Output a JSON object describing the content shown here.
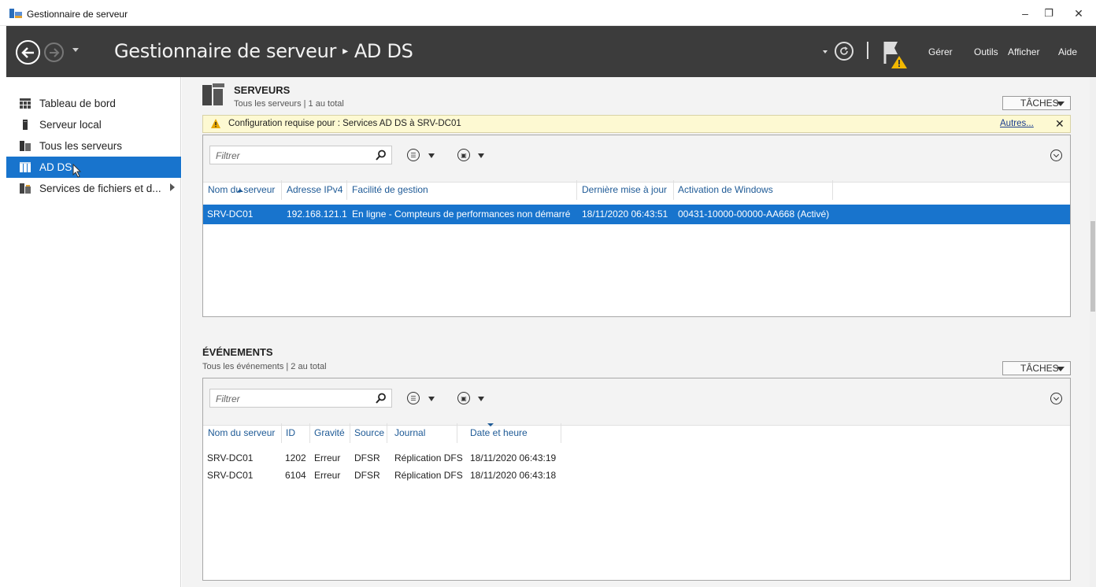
{
  "window": {
    "title": "Gestionnaire de serveur",
    "controls": {
      "minimize": "–",
      "restore": "❐",
      "close": "✕"
    }
  },
  "header": {
    "breadcrumb_root": "Gestionnaire de serveur",
    "breadcrumb_sep": "▸",
    "breadcrumb_current": "AD DS",
    "menu": {
      "manage": "Gérer",
      "tools": "Outils",
      "view": "Afficher",
      "help": "Aide"
    }
  },
  "sidebar": {
    "items": [
      {
        "label": "Tableau de bord",
        "icon": "dashboard-icon"
      },
      {
        "label": "Serveur local",
        "icon": "local-server-icon"
      },
      {
        "label": "Tous les serveurs",
        "icon": "all-servers-icon"
      },
      {
        "label": "AD DS",
        "icon": "ad-ds-icon",
        "active": true
      },
      {
        "label": "Services de fichiers et d...",
        "icon": "file-services-icon"
      }
    ]
  },
  "servers": {
    "title": "SERVEURS",
    "subtitle": "Tous les serveurs | 1 au total",
    "tasks_label": "TÂCHES",
    "notice": {
      "message": "Configuration requise pour : Services AD DS à SRV-DC01",
      "more_link": "Autres...",
      "close": "✕"
    },
    "filter_placeholder": "Filtrer",
    "columns": [
      "Nom du serveur",
      "Adresse IPv4",
      "Facilité de gestion",
      "Dernière mise à jour",
      "Activation de Windows"
    ],
    "rows": [
      [
        "SRV-DC01",
        "192.168.121.1",
        "En ligne - Compteurs de performances non démarré",
        "18/11/2020 06:43:51",
        "00431-10000-00000-AA668 (Activé)"
      ]
    ]
  },
  "events": {
    "title": "ÉVÉNEMENTS",
    "subtitle": "Tous les événements | 2 au total",
    "tasks_label": "TÂCHES",
    "filter_placeholder": "Filtrer",
    "columns": [
      "Nom du serveur",
      "ID",
      "Gravité",
      "Source",
      "Journal",
      "Date et heure"
    ],
    "rows": [
      [
        "SRV-DC01",
        "1202",
        "Erreur",
        "DFSR",
        "Réplication DFS",
        "18/11/2020 06:43:19"
      ],
      [
        "SRV-DC01",
        "6104",
        "Erreur",
        "DFSR",
        "Réplication DFS",
        "18/11/2020 06:43:18"
      ]
    ]
  },
  "colors": {
    "header_bg": "#3c3c3c",
    "selection": "#1874cd",
    "notice_bg": "#fdf9d2",
    "column_header_text": "#1e5a96"
  }
}
